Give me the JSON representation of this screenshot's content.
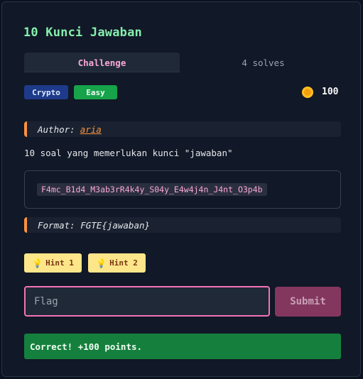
{
  "challenge": {
    "title": "10 Kunci Jawaban",
    "tabs": [
      {
        "label": "Challenge",
        "active": true
      },
      {
        "label": "4 solves",
        "active": false
      }
    ],
    "category": "Crypto",
    "difficulty": "Easy",
    "points": "100",
    "author_prefix": "Author:",
    "author_name": "aria",
    "description": "10 soal yang memerlukan kunci \"jawaban\"",
    "ciphertext": "F4mc_B1d4_M3ab3rR4k4y_S04y_E4w4j4n_J4nt_O3p4b",
    "format": "Format: FGTE{jawaban}",
    "hints": [
      {
        "label": "Hint 1",
        "icon": "lightbulb-icon"
      },
      {
        "label": "Hint 2",
        "icon": "lightbulb-icon"
      }
    ],
    "flag_input": {
      "placeholder": "Flag",
      "value": ""
    },
    "submit_label": "Submit",
    "result_message": "Correct! +100 points."
  },
  "colors": {
    "accent_title": "#86efac",
    "accent_pink": "#f472b6",
    "warning_orange": "#fb923c",
    "success_green": "#15803d"
  }
}
